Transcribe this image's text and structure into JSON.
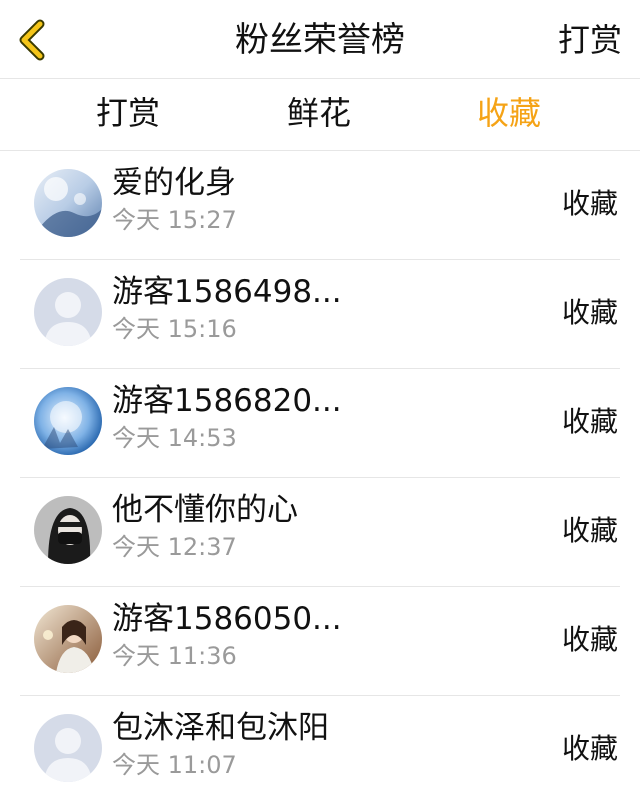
{
  "nav": {
    "title": "粉丝荣誉榜",
    "right_label": "打赏",
    "back_icon": "chevron-left-icon",
    "back_color": "#f5c518"
  },
  "tabs": [
    {
      "label": "打赏",
      "active": false
    },
    {
      "label": "鲜花",
      "active": false
    },
    {
      "label": "收藏",
      "active": true
    }
  ],
  "accent_color": "#f5a316",
  "rows": [
    {
      "name": "爱的化身",
      "time": "今天 15:27",
      "action": "收藏",
      "avatar": "avatar-photo-blue-sky"
    },
    {
      "name": "游客1586498...",
      "time": "今天 15:16",
      "action": "收藏",
      "avatar": "default-user-icon"
    },
    {
      "name": "游客1586820...",
      "time": "今天 14:53",
      "action": "收藏",
      "avatar": "avatar-photo-moon"
    },
    {
      "name": "他不懂你的心",
      "time": "今天 12:37",
      "action": "收藏",
      "avatar": "avatar-photo-masked-girl"
    },
    {
      "name": "游客1586050...",
      "time": "今天 11:36",
      "action": "收藏",
      "avatar": "avatar-photo-woman"
    },
    {
      "name": "包沐泽和包沐阳",
      "time": "今天 11:07",
      "action": "收藏",
      "avatar": "default-user-icon"
    }
  ]
}
